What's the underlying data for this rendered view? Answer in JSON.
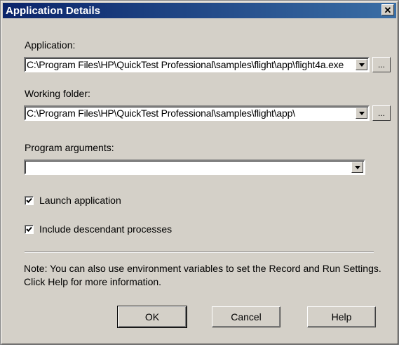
{
  "window": {
    "title": "Application Details",
    "close_glyph": "✕"
  },
  "application": {
    "label": "Application:",
    "value": "C:\\Program Files\\HP\\QuickTest Professional\\samples\\flight\\app\\flight4a.exe",
    "browse_label": "..."
  },
  "working_folder": {
    "label": "Working folder:",
    "value": "C:\\Program Files\\HP\\QuickTest Professional\\samples\\flight\\app\\",
    "browse_label": "..."
  },
  "program_arguments": {
    "label": "Program arguments:",
    "value": ""
  },
  "options": {
    "launch_application": {
      "label": "Launch application",
      "checked": true
    },
    "include_descendant": {
      "label": "Include descendant processes",
      "checked": true
    }
  },
  "note": "Note: You can also use environment variables to set the Record and Run Settings. Click Help for more information.",
  "buttons": {
    "ok": "OK",
    "cancel": "Cancel",
    "help": "Help"
  }
}
